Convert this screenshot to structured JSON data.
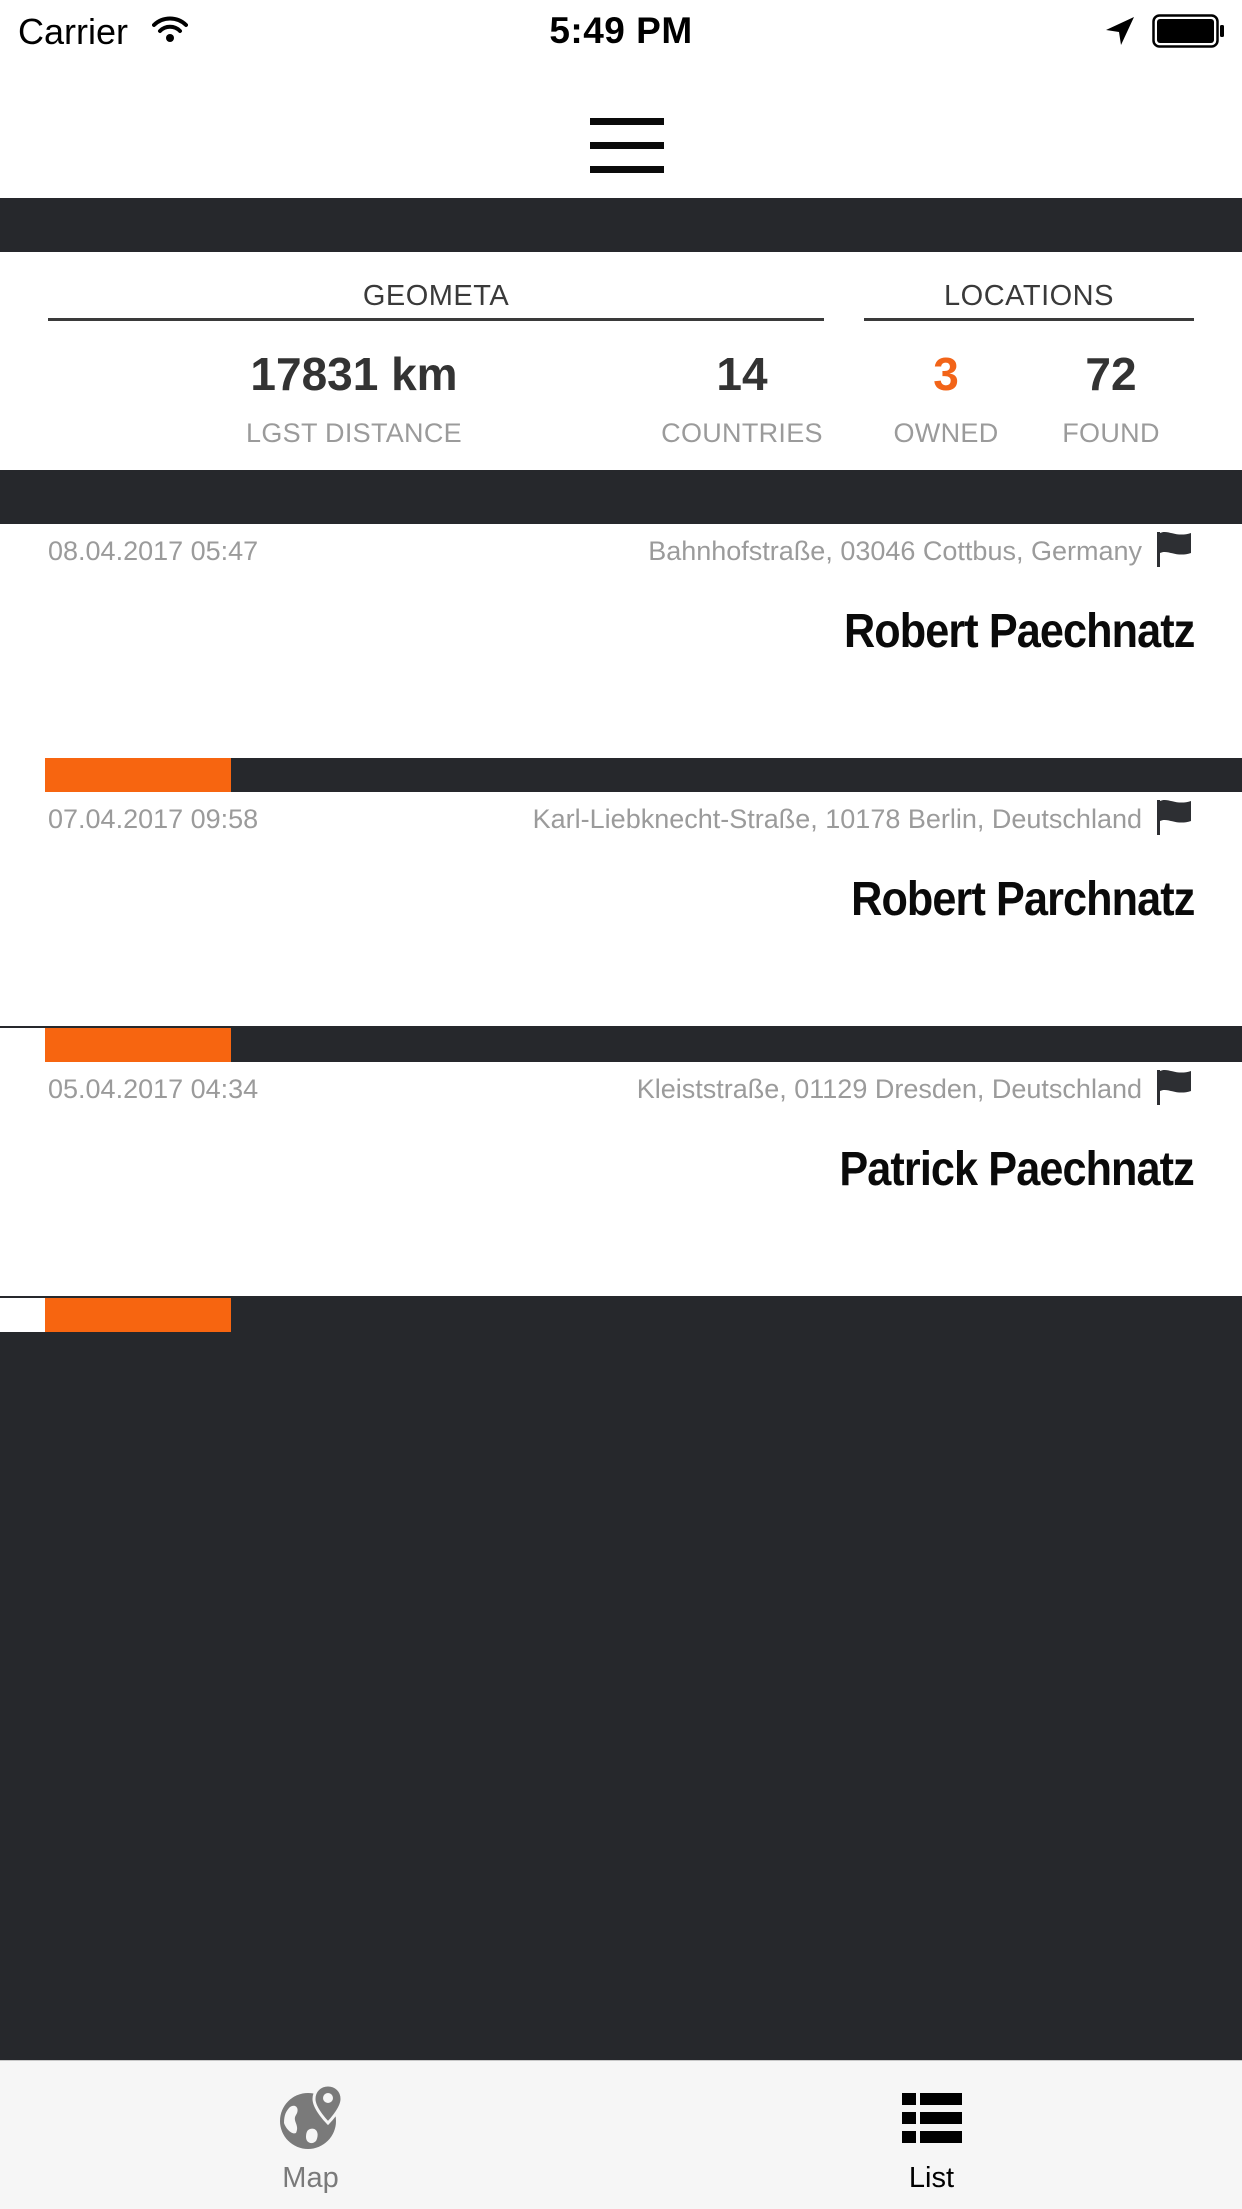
{
  "status_bar": {
    "carrier": "Carrier",
    "time": "5:49 PM"
  },
  "header": {
    "menu_icon": "hamburger-menu-icon"
  },
  "stats": {
    "geometa": {
      "title": "GEOMETA",
      "distance": {
        "value": "17831 km",
        "label": "LGST DISTANCE"
      },
      "countries": {
        "value": "14",
        "label": "COUNTRIES"
      }
    },
    "locations": {
      "title": "LOCATIONS",
      "owned": {
        "value": "3",
        "label": "OWNED"
      },
      "found": {
        "value": "72",
        "label": "FOUND"
      }
    }
  },
  "list": {
    "items": [
      {
        "date": "08.04.2017 05:47",
        "address": "Bahnhofstraße, 03046 Cottbus, Germany",
        "name": "Robert Paechnatz",
        "progress": 0.155
      },
      {
        "date": "07.04.2017 09:58",
        "address": "Karl-Liebknecht-Straße, 10178 Berlin, Deutschland",
        "name": "Robert Parchnatz",
        "progress": 0.155
      },
      {
        "date": "05.04.2017 04:34",
        "address": "Kleiststraße, 01129 Dresden, Deutschland",
        "name": "Patrick Paechnatz",
        "progress": 0.155
      }
    ]
  },
  "tab_bar": {
    "tabs": [
      {
        "label": "Map",
        "icon": "globe-pin-icon",
        "selected": false
      },
      {
        "label": "List",
        "icon": "list-icon",
        "selected": true
      }
    ]
  },
  "colors": {
    "accent": "#f76510",
    "dark": "#26282c",
    "muted_text": "#9b9b9b",
    "tab_inactive": "#7a7a7a",
    "tab_active": "#000000"
  }
}
